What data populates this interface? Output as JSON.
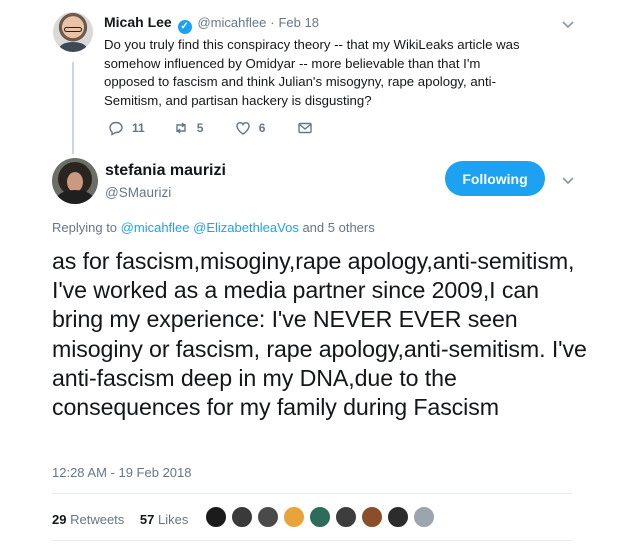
{
  "parent_tweet": {
    "name": "Micah Lee",
    "handle": "@micahflee",
    "date": "Feb 18",
    "text": "Do you truly find this conspiracy theory -- that my WikiLeaks article was somehow influenced by Omidyar -- more believable than that I'm opposed to fascism and think Julian's misogyny, rape apology, anti-Semitism, and partisan hackery is disgusting?",
    "replies": "11",
    "retweets": "5",
    "likes": "6"
  },
  "main_tweet": {
    "name": "stefania maurizi",
    "handle": "@SMaurizi",
    "follow_label": "Following",
    "replying_prefix": "Replying to",
    "replying_mentions": "@micahflee @ElizabethleaVos",
    "replying_suffix": "and 5 others",
    "text": "as for fascism,misoginy,rape apology,anti-semitism, I've worked as a media partner since 2009,I can bring my experience: I've NEVER EVER seen misoginy or fascism, rape apology,anti-semitism. I've anti-fascism deep in my DNA,due to the consequences for my family during Fascism",
    "timestamp": "12:28 AM - 19 Feb 2018",
    "retweet_count": "29",
    "retweet_label": "Retweets",
    "like_count": "57",
    "like_label": "Likes"
  },
  "liker_avatar_colors": [
    "#1b1b1b",
    "#3a3a3a",
    "#4a4a4a",
    "#e8a33b",
    "#2f6b5a",
    "#3d3d3d",
    "#8a4f2a",
    "#2c2c2c",
    "#9aa5ad"
  ],
  "colors": {
    "accent": "#1da1f2",
    "text": "#14171a",
    "muted": "#657786"
  }
}
